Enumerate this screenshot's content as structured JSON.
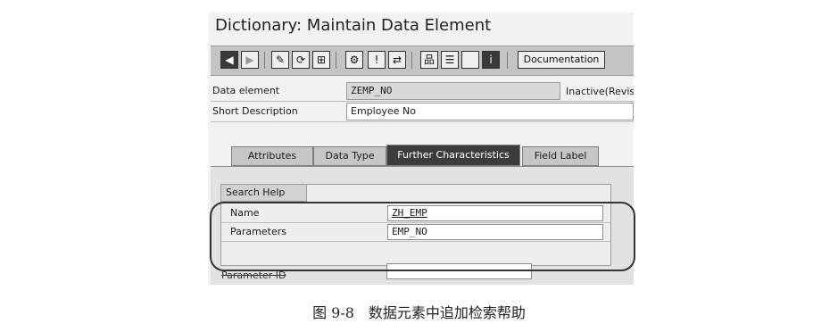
{
  "window": {
    "title": "Dictionary: Maintain Data Element"
  },
  "toolbar": {
    "icons": [
      "back-icon",
      "forward-icon",
      "display-change-icon",
      "other-object-icon",
      "where-used-icon",
      "activate-icon",
      "check-icon",
      "navigate-icon",
      "hierarchy-icon",
      "display-object-list-icon",
      "blank-icon",
      "info-icon"
    ],
    "documentation_label": "Documentation"
  },
  "header": {
    "data_element_label": "Data element",
    "data_element_value": "ZEMP_NO",
    "status_text": "Inactive(Revis",
    "short_description_label": "Short Description",
    "short_description_value": "Employee No"
  },
  "tabs": [
    {
      "label": "Attributes",
      "active": false
    },
    {
      "label": "Data Type",
      "active": false
    },
    {
      "label": "Further Characteristics",
      "active": true
    },
    {
      "label": "Field Label",
      "active": false
    }
  ],
  "search_help": {
    "group_title": "Search Help",
    "name_label": "Name",
    "name_value": "ZH_EMP",
    "parameters_label": "Parameters",
    "parameters_value": "EMP_NO"
  },
  "parameter_id": {
    "label": "Parameter ID",
    "value": ""
  },
  "caption": "图 9-8　数据元素中追加检索帮助"
}
